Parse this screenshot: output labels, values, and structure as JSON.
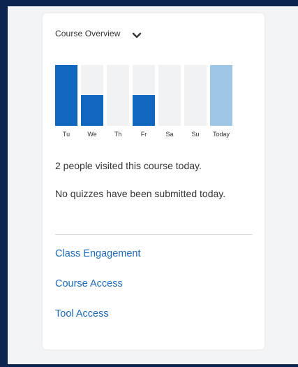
{
  "widget": {
    "title": "Course Overview",
    "stat_visits": "2 people visited this course today.",
    "stat_quizzes": "No quizzes have been submitted today."
  },
  "links": [
    {
      "label": "Class Engagement"
    },
    {
      "label": "Course Access"
    },
    {
      "label": "Tool Access"
    }
  ],
  "colors": {
    "bar_active": "#1167be",
    "bar_today": "#9ec6e6",
    "bar_empty": "#f1f2f4",
    "link": "#1c6ab8"
  },
  "chart_data": {
    "type": "bar",
    "categories": [
      "Tu",
      "We",
      "Th",
      "Fr",
      "Sa",
      "Su",
      "Today"
    ],
    "values": [
      1,
      0.5,
      0,
      0.5,
      0,
      0,
      1
    ],
    "highlight": "Today",
    "ylim": [
      0,
      1
    ],
    "grid": false
  }
}
